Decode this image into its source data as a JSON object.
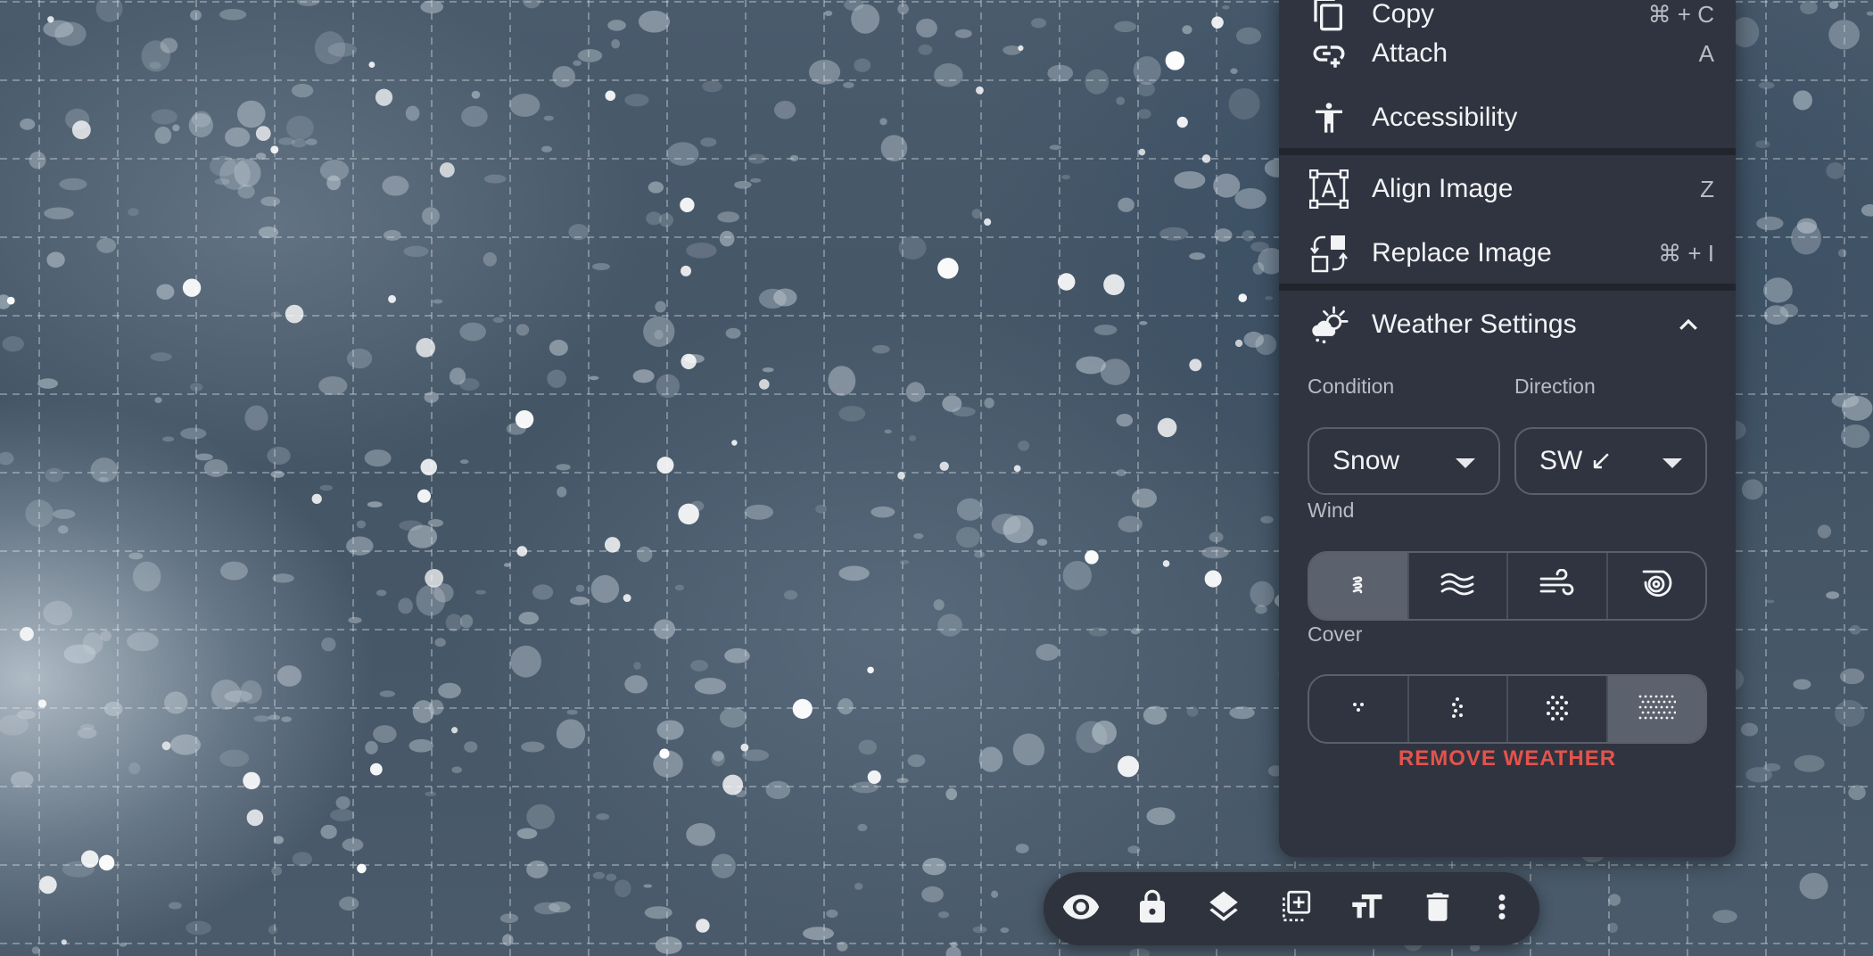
{
  "menu": {
    "items": [
      {
        "icon": "copy-icon",
        "label": "Copy",
        "shortcut": "⌘ + C"
      },
      {
        "icon": "attach-icon",
        "label": "Attach",
        "shortcut": "A"
      },
      {
        "icon": "accessibility-icon",
        "label": "Accessibility",
        "shortcut": ""
      },
      {
        "icon": "align-image-icon",
        "label": "Align Image",
        "shortcut": "Z"
      },
      {
        "icon": "replace-image-icon",
        "label": "Replace Image",
        "shortcut": "⌘ + I"
      }
    ],
    "weather": {
      "title": "Weather Settings",
      "expanded": true,
      "condition": {
        "label": "Condition",
        "value": "Snow"
      },
      "direction": {
        "label": "Direction",
        "value": "SW ↙"
      },
      "wind": {
        "label": "Wind",
        "options": [
          "wind-light-icon",
          "wind-medium-icon",
          "wind-strong-icon",
          "wind-storm-icon"
        ],
        "selected_index": 0
      },
      "cover": {
        "label": "Cover",
        "options": [
          "cover-light-icon",
          "cover-medium-icon",
          "cover-heavy-icon",
          "cover-very-heavy-icon"
        ],
        "selected_index": 3
      },
      "remove_label": "REMOVE WEATHER"
    }
  },
  "toolbar": {
    "buttons": [
      "visibility-icon",
      "lock-icon",
      "layers-icon",
      "select-add-icon",
      "text-size-icon",
      "delete-icon",
      "more-vertical-icon"
    ]
  },
  "colors": {
    "menu_bg": "#303440",
    "remove_accent": "#e5534b",
    "active_segment": "#5b616d"
  }
}
